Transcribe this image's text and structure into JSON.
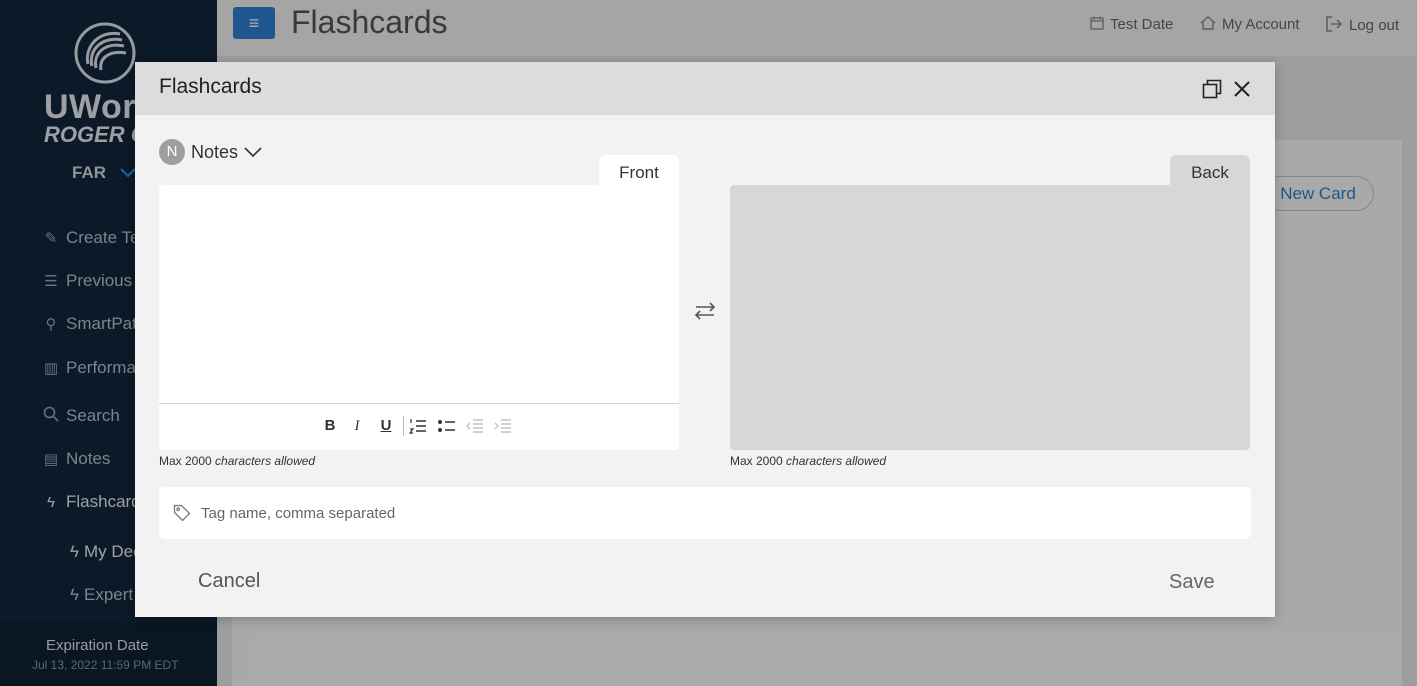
{
  "app": {
    "logo_text": "UWorld",
    "logo_sub": "ROGER CPA",
    "exam": "FAR",
    "page_title": "Flashcards"
  },
  "sidebar": {
    "items": [
      {
        "label": "Create Test",
        "icon": "edit-icon"
      },
      {
        "label": "Previous Tests",
        "icon": "list-icon"
      },
      {
        "label": "SmartPath",
        "icon": "path-icon"
      },
      {
        "label": "Performance",
        "icon": "chart-icon"
      },
      {
        "label": "Search",
        "icon": "search-icon"
      },
      {
        "label": "Notes",
        "icon": "document-icon"
      },
      {
        "label": "Flashcards",
        "icon": "bolt-icon"
      }
    ],
    "subitems": [
      {
        "label": "My Decks",
        "icon": "bolt-outline-icon"
      },
      {
        "label": "Expert Decks",
        "icon": "bolt-outline-icon"
      }
    ],
    "expiration_label": "Expiration Date",
    "expiration_date": "Jul 13, 2022 11:59 PM EDT"
  },
  "header": {
    "links": [
      {
        "label": "Test Date",
        "icon": "calendar-icon"
      },
      {
        "label": "My Account",
        "icon": "home-icon"
      },
      {
        "label": "Log out",
        "icon": "logout-icon"
      }
    ]
  },
  "page": {
    "new_card_label": "New Card"
  },
  "modal": {
    "title": "Flashcards",
    "deck_initial": "N",
    "deck_name": "Notes",
    "front_tab": "Front",
    "back_tab": "Back",
    "front_value": "",
    "char_limit": "Max 2000",
    "char_limit_suffix": "characters allowed",
    "tag_placeholder": "Tag name, comma separated",
    "cancel_label": "Cancel",
    "save_label": "Save",
    "toolbar": {
      "bold": "B",
      "italic": "I",
      "underline": "U"
    }
  },
  "colors": {
    "sidebar_bg": "#12263b",
    "accent": "#2f7fd3",
    "modal_header": "#dcdcdc",
    "back_panel": "#d7d7d7"
  }
}
